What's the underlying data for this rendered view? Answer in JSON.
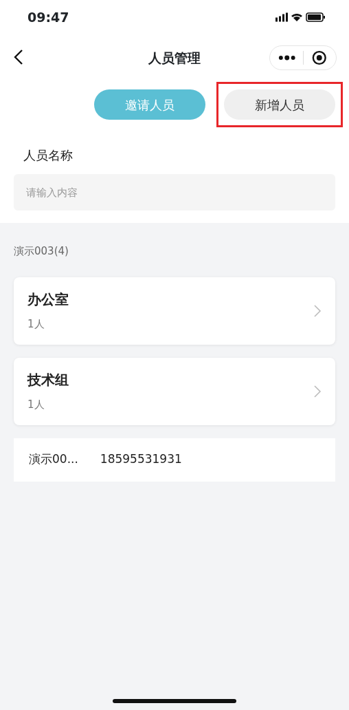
{
  "status_bar": {
    "time": "09:47"
  },
  "nav": {
    "title": "人员管理"
  },
  "actions": [
    {
      "label": "邀请人员",
      "kind": "primary",
      "highlighted": false
    },
    {
      "label": "新增人员",
      "kind": "secondary",
      "highlighted": true
    }
  ],
  "search": {
    "label": "人员名称",
    "placeholder": "请输入内容"
  },
  "org": {
    "title": "演示003(4)"
  },
  "groups": [
    {
      "name": "办公室",
      "count": "1人"
    },
    {
      "name": "技术组",
      "count": "1人"
    }
  ],
  "members": [
    {
      "name": "演示00...",
      "phone": "18595531931"
    }
  ]
}
